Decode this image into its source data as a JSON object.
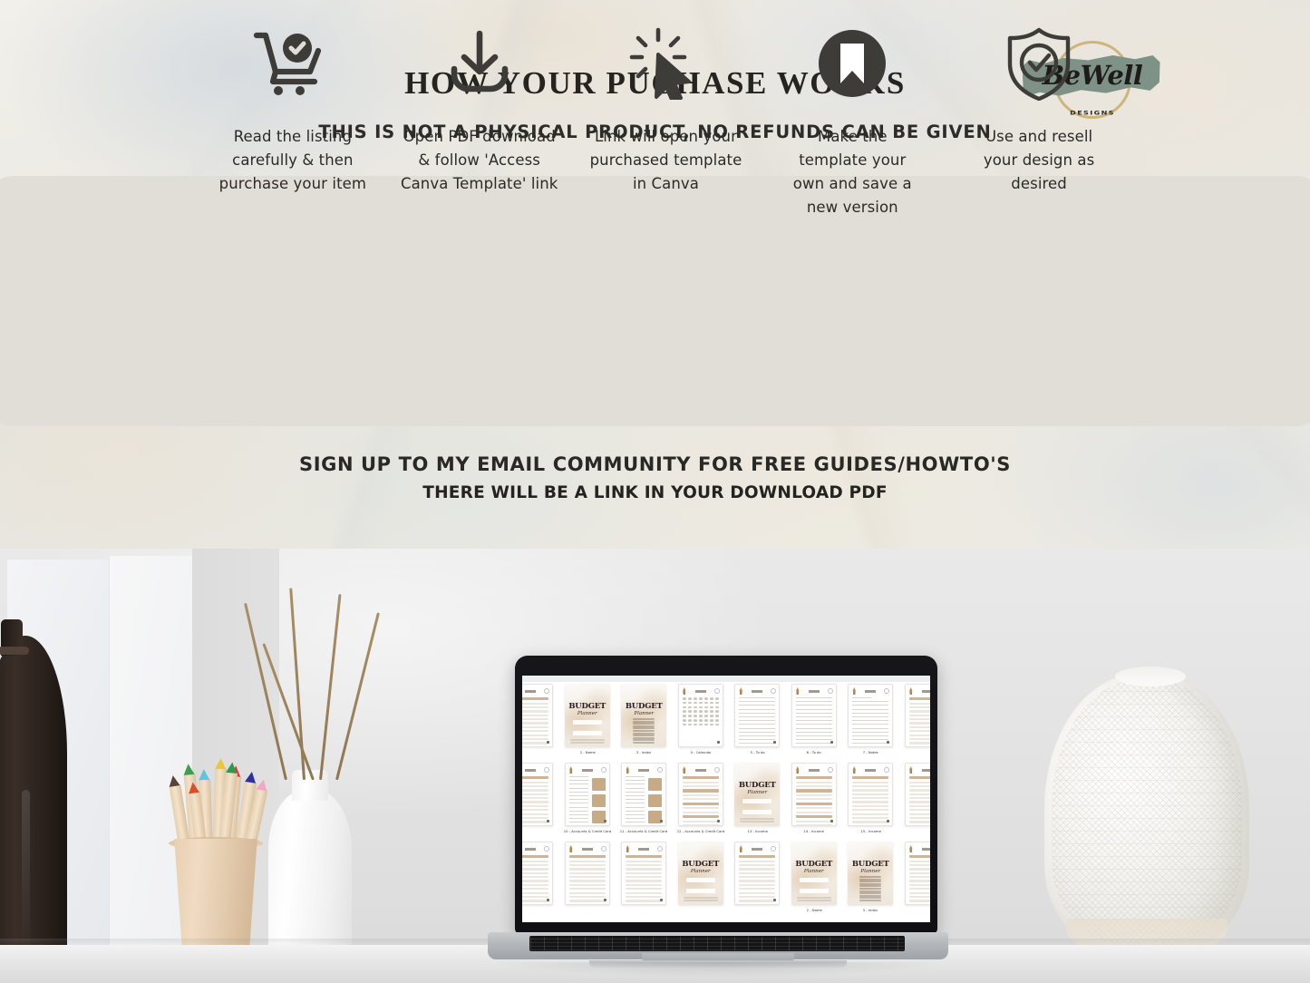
{
  "header": {
    "title": "HOW YOUR PUCHASE WORKS",
    "subtitle": "THIS IS NOT A PHYSICAL PRODUCT, NO REFUNDS CAN BE GIVEN"
  },
  "logo": {
    "name": "BeWell",
    "sub": "DESIGNS",
    "brush_color": "#7f9287",
    "ring_color": "#c8ac6b"
  },
  "steps": {
    "panel_color": "#e1ded7",
    "items": [
      {
        "icon": "shopping-cart-check-icon",
        "caption": "Read the listing carefully & then purchase your item"
      },
      {
        "icon": "download-icon",
        "caption": "Open PDF download & follow 'Access Canva Template' link"
      },
      {
        "icon": "click-cursor-icon",
        "caption": "Link will open your purchased template in Canva"
      },
      {
        "icon": "bookmark-circle-icon",
        "caption": "Make the template your own and save a new version"
      },
      {
        "icon": "shield-check-icon",
        "caption": "Use and resell your design as desired"
      }
    ]
  },
  "cta": {
    "line1": "SIGN UP TO MY EMAIL COMMUNITY FOR FREE GUIDES/HOWTO'S",
    "line2": "THERE WILL BE A LINK IN YOUR DOWNLOAD PDF"
  },
  "scene": {
    "laptop": {
      "screen_title": "BUDGET",
      "screen_subtitle": "Planner",
      "thumbnails": [
        {
          "label": "2 - Name",
          "type": "cover"
        },
        {
          "label": "3 - Index",
          "type": "cover-list"
        },
        {
          "label": "4 - Calendar",
          "type": "calendar"
        },
        {
          "label": "5 - To do",
          "type": "lines"
        },
        {
          "label": "6 - To do",
          "type": "lines"
        },
        {
          "label": "7 - Notes",
          "type": "notes"
        },
        {
          "label": "10 - Accounts & Credit Card",
          "type": "table-block"
        },
        {
          "label": "11 - Accounts & Credit Card",
          "type": "table-block"
        },
        {
          "label": "12 - Accounts & Credit Card",
          "type": "bars"
        },
        {
          "label": "13 - Income",
          "type": "cover"
        },
        {
          "label": "14 - Income",
          "type": "bars"
        },
        {
          "label": "15 - Income",
          "type": "table"
        },
        {
          "label": "",
          "type": "table"
        },
        {
          "label": "",
          "type": "table"
        },
        {
          "label": "",
          "type": "cover"
        },
        {
          "label": "",
          "type": "table"
        }
      ]
    },
    "objects": [
      {
        "name": "dark-glass-bottle"
      },
      {
        "name": "colored-pencils-cup"
      },
      {
        "name": "white-vase-with-branches"
      },
      {
        "name": "textured-ceramic-vase"
      }
    ],
    "pencil_colors": [
      "#5b4033",
      "#3aa14a",
      "#5fc4de",
      "#e8c73c",
      "#e03a3a",
      "#2f2f9e",
      "#f2a8c4",
      "#d94f2a",
      "#2f9a4f"
    ]
  }
}
